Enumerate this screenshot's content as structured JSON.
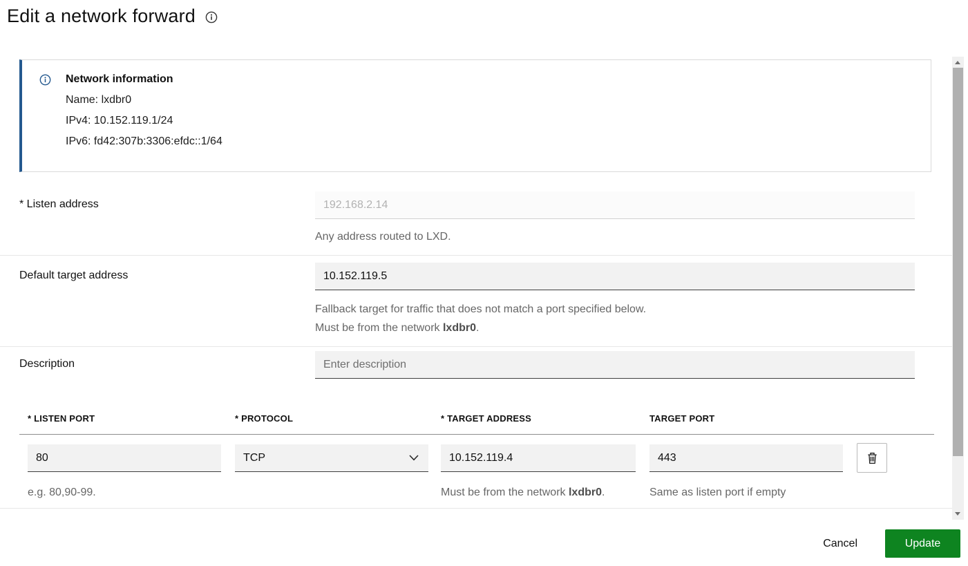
{
  "page": {
    "title": "Edit a network forward"
  },
  "notification": {
    "title": "Network information",
    "lines": [
      "Name: lxdbr0",
      "IPv4: 10.152.119.1/24",
      "IPv6: fd42:307b:3306:efdc::1/64"
    ]
  },
  "fields": {
    "listen_address": {
      "label": "* Listen address",
      "value": "192.168.2.14",
      "help": "Any address routed to LXD."
    },
    "default_target_address": {
      "label": "Default target address",
      "value": "10.152.119.5",
      "help_line1": "Fallback target for traffic that does not match a port specified below.",
      "help_line2_prefix": "Must be from the network ",
      "network_name": "lxdbr0",
      "help_line2_suffix": "."
    },
    "description": {
      "label": "Description",
      "placeholder": "Enter description"
    }
  },
  "ports_table": {
    "headers": [
      "* LISTEN PORT",
      "* PROTOCOL",
      "* TARGET ADDRESS",
      "TARGET PORT"
    ],
    "row": {
      "listen_port": "80",
      "protocol": "TCP",
      "target_address": "10.152.119.4",
      "target_port": "443"
    },
    "help": {
      "listen_port": "e.g. 80,90-99.",
      "target_address_prefix": "Must be from the network ",
      "network_name": "lxdbr0",
      "target_address_suffix": ".",
      "target_port": "Same as listen port if empty"
    }
  },
  "footer": {
    "cancel_label": "Cancel",
    "update_label": "Update"
  },
  "colors": {
    "accent_green": "#0e8420",
    "info_blue": "#24598f"
  }
}
